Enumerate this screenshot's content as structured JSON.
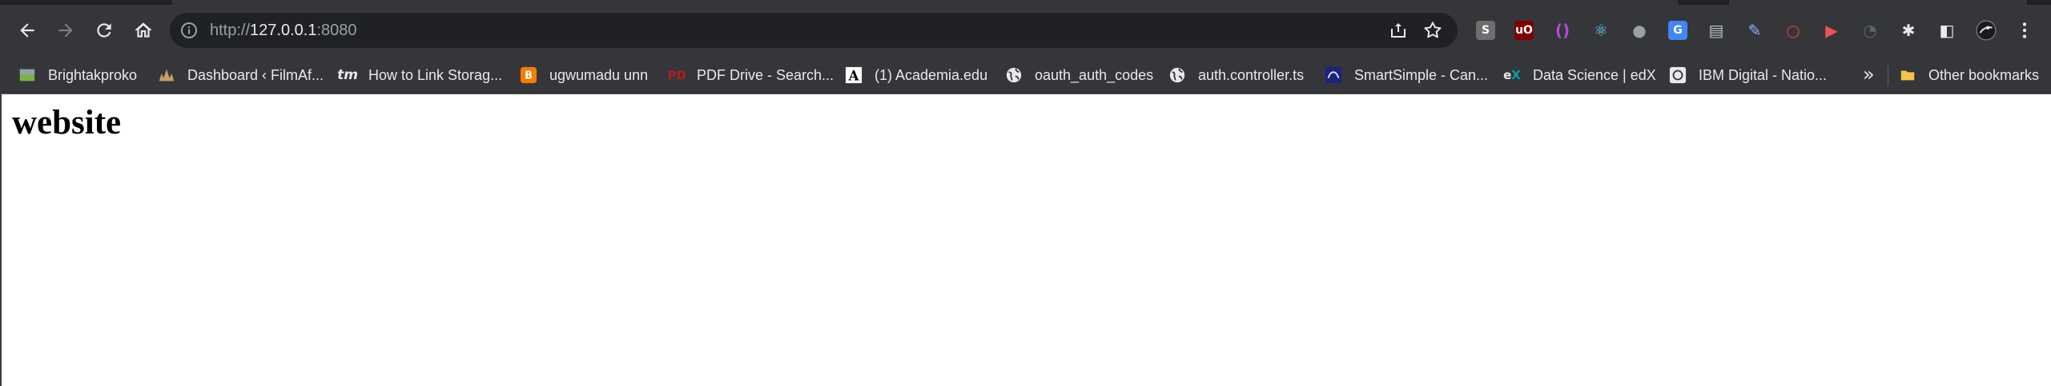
{
  "browser": {
    "address_bar": {
      "scheme": "http://",
      "host": "127.0.0.1",
      "port": ":8080"
    },
    "toolbar_icons": [
      "back-icon",
      "forward-icon",
      "reload-icon",
      "home-icon"
    ],
    "extensions": [
      {
        "name": "extension-s",
        "glyph": "S",
        "color": "#6f6f6f"
      },
      {
        "name": "ublock-origin",
        "glyph": "uO",
        "color": "#800000"
      },
      {
        "name": "extension-brackets",
        "glyph": "()",
        "color": "#b24bd6"
      },
      {
        "name": "react-devtools",
        "glyph": "⚛",
        "color": "#61dafb"
      },
      {
        "name": "extension-grey",
        "glyph": "●",
        "color": "#9aa0a6"
      },
      {
        "name": "google-translate",
        "glyph": "G",
        "color": "#4285f4"
      },
      {
        "name": "extension-doc",
        "glyph": "▤",
        "color": "#bdc1c6"
      },
      {
        "name": "extension-pen",
        "glyph": "✎",
        "color": "#8ab4f8"
      },
      {
        "name": "extension-red-ring",
        "glyph": "○",
        "color": "#e53935"
      },
      {
        "name": "extension-video",
        "glyph": "▶",
        "color": "#ef5350"
      },
      {
        "name": "extension-gauge",
        "glyph": "◔",
        "color": "#5f6368"
      },
      {
        "name": "extensions-puzzle",
        "glyph": "✱",
        "color": "#e8eaed"
      },
      {
        "name": "side-panel",
        "glyph": "◧",
        "color": "#e8eaed"
      }
    ]
  },
  "bookmarks": {
    "items": [
      {
        "label": "Brightakproko",
        "icon": "image-icon"
      },
      {
        "label": "Dashboard ‹ FilmAf...",
        "icon": "wordpress-icon"
      },
      {
        "label": "How to Link Storag...",
        "icon": "tm-icon"
      },
      {
        "label": "ugwumadu unn",
        "icon": "blogger-icon"
      },
      {
        "label": "PDF Drive - Search...",
        "icon": "pdfdrive-icon"
      },
      {
        "label": "(1) Academia.edu",
        "icon": "academia-icon"
      },
      {
        "label": "oauth_auth_codes",
        "icon": "globe-icon"
      },
      {
        "label": "auth.controller.ts",
        "icon": "globe-icon"
      },
      {
        "label": "SmartSimple - Can...",
        "icon": "smartsimple-icon"
      },
      {
        "label": "Data Science | edX",
        "icon": "edx-icon"
      },
      {
        "label": "IBM Digital - Natio...",
        "icon": "ibm-icon"
      }
    ],
    "overflow": "»",
    "other": {
      "label": "Other bookmarks",
      "icon": "folder-icon"
    }
  },
  "page": {
    "heading": "website"
  }
}
